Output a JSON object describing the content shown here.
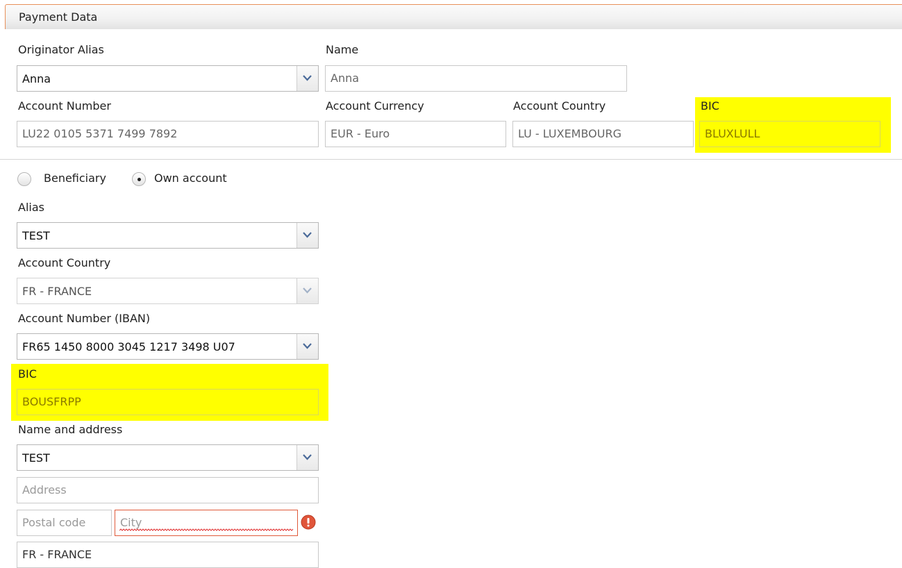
{
  "header": {
    "title": "Payment Data"
  },
  "originator": {
    "alias_label": "Originator Alias",
    "alias_value": "Anna",
    "name_label": "Name",
    "name_value": "Anna",
    "account_number_label": "Account Number",
    "account_number_value": "LU22 0105 5371 7499 7892",
    "account_currency_label": "Account Currency",
    "account_currency_value": "EUR - Euro",
    "account_country_label": "Account Country",
    "account_country_value": "LU - LUXEMBOURG",
    "bic_label": "BIC",
    "bic_value": "BLUXLULL"
  },
  "beneficiary": {
    "radio_beneficiary_label": "Beneficiary",
    "radio_own_account_label": "Own account",
    "selected_radio": "Own account",
    "alias_label": "Alias",
    "alias_value": "TEST",
    "account_country_label": "Account Country",
    "account_country_value": "FR - FRANCE",
    "iban_label": "Account Number (IBAN)",
    "iban_value": "FR65 1450 8000 3045 1217 3498 U07",
    "bic_label": "BIC",
    "bic_value": "BOUSFRPP",
    "name_address_label": "Name and address",
    "name_value": "TEST",
    "address_placeholder": "Address",
    "postal_code_placeholder": "Postal code",
    "city_placeholder": "City",
    "country_value": "FR - FRANCE"
  },
  "colors": {
    "highlight": "#ffff00",
    "header_border": "#e8905a",
    "error": "#e05a3a"
  },
  "icons": {
    "dropdown": "chevron-down-icon",
    "error": "error-icon"
  }
}
